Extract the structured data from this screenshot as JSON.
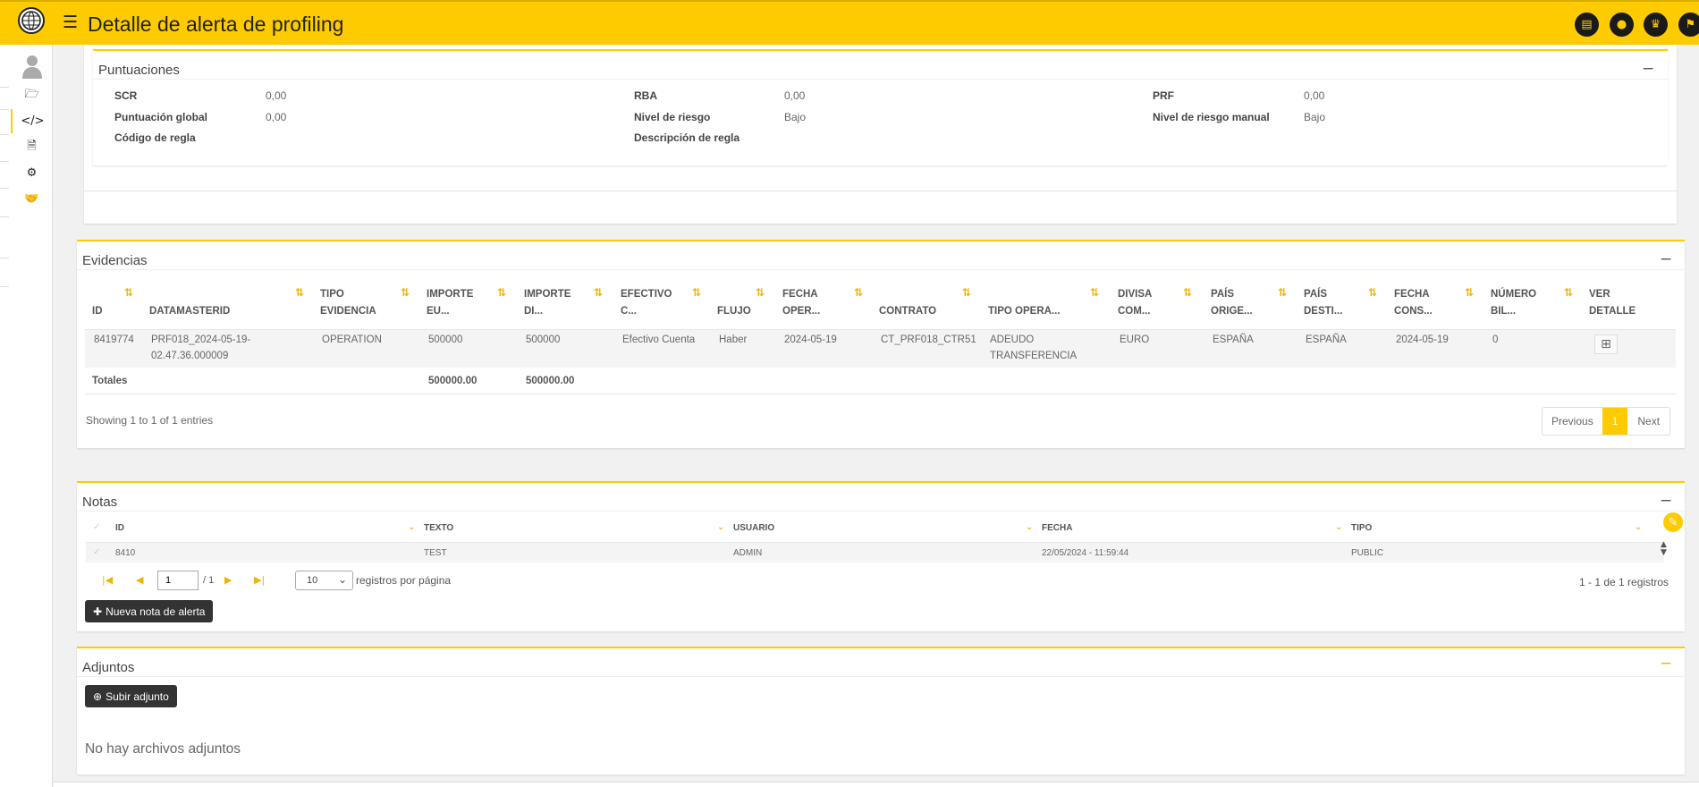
{
  "header": {
    "title": "Detalle de alerta de profiling",
    "menu_icon": "☰",
    "icons": [
      "calendar-icon",
      "user-icon",
      "queen-icon",
      "flag-icon"
    ]
  },
  "sidebar": {
    "items": [
      "avatar",
      "folder-open-icon",
      "code-icon",
      "pdf-icon",
      "gear-icon",
      "handshake-icon"
    ]
  },
  "colors": {
    "brand": "#fecb00",
    "dark": "#1a1a1a"
  },
  "puntuaciones": {
    "title": "Puntuaciones",
    "collapse": "−",
    "rows": [
      [
        {
          "label": "SCR",
          "value": "0,00"
        },
        {
          "label": "RBA",
          "value": "0,00"
        },
        {
          "label": "PRF",
          "value": "0,00"
        }
      ],
      [
        {
          "label": "Puntuación global",
          "value": "0,00"
        },
        {
          "label": "Nivel de riesgo",
          "value": "Bajo"
        },
        {
          "label": "Nivel de riesgo manual",
          "value": "Bajo"
        }
      ],
      [
        {
          "label": "Código de regla",
          "value": ""
        },
        {
          "label": "Descripción de regla",
          "value": ""
        }
      ]
    ]
  },
  "evidencias": {
    "title": "Evidencias",
    "collapse": "−",
    "sort_icon": "⇅",
    "headers": [
      "ID",
      "DATAMASTERID",
      "TIPO\nEVIDENCIA",
      "IMPORTE\nEU...",
      "IMPORTE\nDI...",
      "EFECTIVO\nC...",
      "FLUJO",
      "FECHA\nOPER...",
      "CONTRATO",
      "TIPO OPERA...",
      "DIVISA\nCOM...",
      "PAÍS\nORIGE...",
      "PAÍS\nDESTI...",
      "FECHA\nCONS...",
      "NÚMERO\nBIL...",
      "VER\nDETALLE"
    ],
    "row": [
      "8419774",
      "PRF018_2024-05-19-\n02.47.36.000009",
      "OPERATION",
      "500000",
      "500000",
      "Efectivo Cuenta",
      "Haber",
      "2024-05-19",
      "CT_PRF018_CTR51",
      "ADEUDO\nTRANSFERENCIA",
      "EURO",
      "ESPAÑA",
      "ESPAÑA",
      "2024-05-19",
      "0"
    ],
    "detail_icon": "⊞",
    "totals_label": "Totales",
    "total_eu": "500000.00",
    "total_di": "500000.00",
    "info": "Showing 1 to 1 of 1 entries",
    "prev": "Previous",
    "page": "1",
    "next": "Next"
  },
  "notas": {
    "title": "Notas",
    "collapse": "−",
    "edit_icon": "✎",
    "headers": [
      "ID",
      "TEXTO",
      "USUARIO",
      "FECHA",
      "TIPO"
    ],
    "row": [
      "8410",
      "TEST",
      "ADMIN",
      "22/05/2024 - 11:59:44",
      "PUBLIC"
    ],
    "check_icon": "✓",
    "sort_icon": "⌄",
    "nav": {
      "first": "|◀",
      "prev": "◀",
      "next": "▶",
      "last": "▶|"
    },
    "page_value": "1",
    "page_total": "/ 1",
    "per_page": "10",
    "per_page_label": "registros por página",
    "range": "1 - 1 de 1 registros",
    "new_button_icon": "✚",
    "new_button": "Nueva nota de alerta"
  },
  "adjuntos": {
    "title": "Adjuntos",
    "collapse": "−",
    "upload_icon": "⊕",
    "upload": "Subir adjunto",
    "empty": "No hay archivos adjuntos"
  }
}
